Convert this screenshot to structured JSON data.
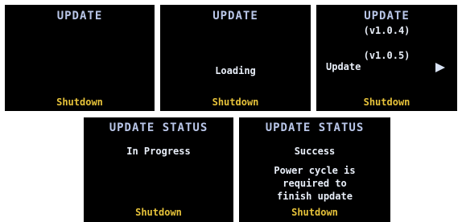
{
  "screens": [
    {
      "title": "UPDATE",
      "footer": "Shutdown"
    },
    {
      "title": "UPDATE",
      "status": "Loading",
      "footer": "Shutdown"
    },
    {
      "title": "UPDATE",
      "current_version": "(v1.0.4)",
      "new_version": "(v1.0.5)",
      "action_label": "Update",
      "action_icon": "right-arrow-icon",
      "footer": "Shutdown"
    },
    {
      "title": "UPDATE STATUS",
      "status": "In Progress",
      "footer": "Shutdown"
    },
    {
      "title": "UPDATE STATUS",
      "status": "Success",
      "message_lines": [
        "Power cycle is",
        "required to",
        "finish update"
      ],
      "footer": "Shutdown"
    }
  ],
  "colors": {
    "screen_bg": "#000000",
    "title": "#b9c6e8",
    "text": "#e8eef8",
    "footer": "#e6c23a"
  }
}
